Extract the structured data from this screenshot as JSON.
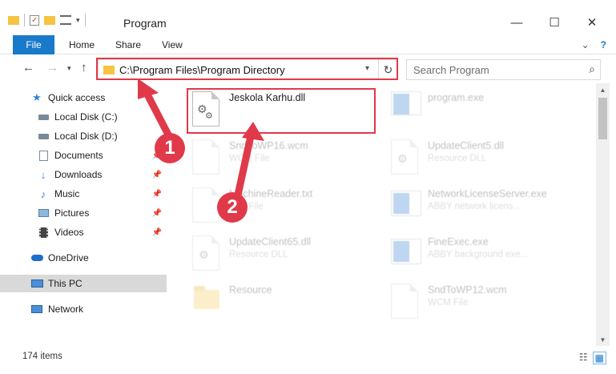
{
  "window": {
    "title": "Program",
    "minimize_glyph": "—",
    "maximize_glyph": "☐",
    "close_glyph": "✕"
  },
  "ribbon": {
    "file_tab": "File",
    "tabs": [
      "Home",
      "Share",
      "View"
    ],
    "expand_glyph": "⌄",
    "help_glyph": "?"
  },
  "address": {
    "path": "C:\\Program Files\\Program Directory",
    "refresh_glyph": "↻"
  },
  "search": {
    "placeholder": "Search Program"
  },
  "sidebar": {
    "items": [
      {
        "label": "Quick access",
        "icon": "star-icon"
      },
      {
        "label": "Local Disk (C:)",
        "icon": "drive-icon"
      },
      {
        "label": "Local Disk (D:)",
        "icon": "drive-icon"
      },
      {
        "label": "Documents",
        "icon": "documents-icon",
        "pinned": true
      },
      {
        "label": "Downloads",
        "icon": "download-icon",
        "pinned": true
      },
      {
        "label": "Music",
        "icon": "music-icon",
        "pinned": true
      },
      {
        "label": "Pictures",
        "icon": "pictures-icon",
        "pinned": true
      },
      {
        "label": "Videos",
        "icon": "videos-icon",
        "pinned": true
      },
      {
        "label": "OneDrive",
        "icon": "cloud-icon"
      },
      {
        "label": "This PC",
        "icon": "computer-icon"
      },
      {
        "label": "Network",
        "icon": "network-icon"
      }
    ]
  },
  "files": [
    {
      "name": "Jeskola Karhu.dll",
      "type": "",
      "icon": "dll-icon",
      "highlight": true
    },
    {
      "name": "program.exe",
      "type": "",
      "icon": "exe-icon"
    },
    {
      "name": "SndToWP16.wcm",
      "type": "WCM File",
      "icon": "file-icon"
    },
    {
      "name": "UpdateClient5.dll",
      "type": "Resource DLL",
      "icon": "dll-icon"
    },
    {
      "name": "MachineReader.txt",
      "type": "Text File",
      "icon": "file-icon"
    },
    {
      "name": "NetworkLicenseServer.exe",
      "type": "ABBY network licens...",
      "icon": "app-icon"
    },
    {
      "name": "UpdateClient65.dll",
      "type": "Resource DLL",
      "icon": "dll-icon"
    },
    {
      "name": "FineExec.exe",
      "type": "ABBY background exe...",
      "icon": "app-icon"
    },
    {
      "name": "Resource",
      "type": "",
      "icon": "folder-icon"
    },
    {
      "name": "SndToWP12.wcm",
      "type": "WCM File",
      "icon": "file-icon"
    }
  ],
  "status": {
    "count": "174 items"
  },
  "annotations": {
    "step1": "1",
    "step2": "2"
  },
  "colors": {
    "accent": "#1979ca",
    "highlight_red": "#e03a4a",
    "selected_bg": "#d9d9d9"
  }
}
